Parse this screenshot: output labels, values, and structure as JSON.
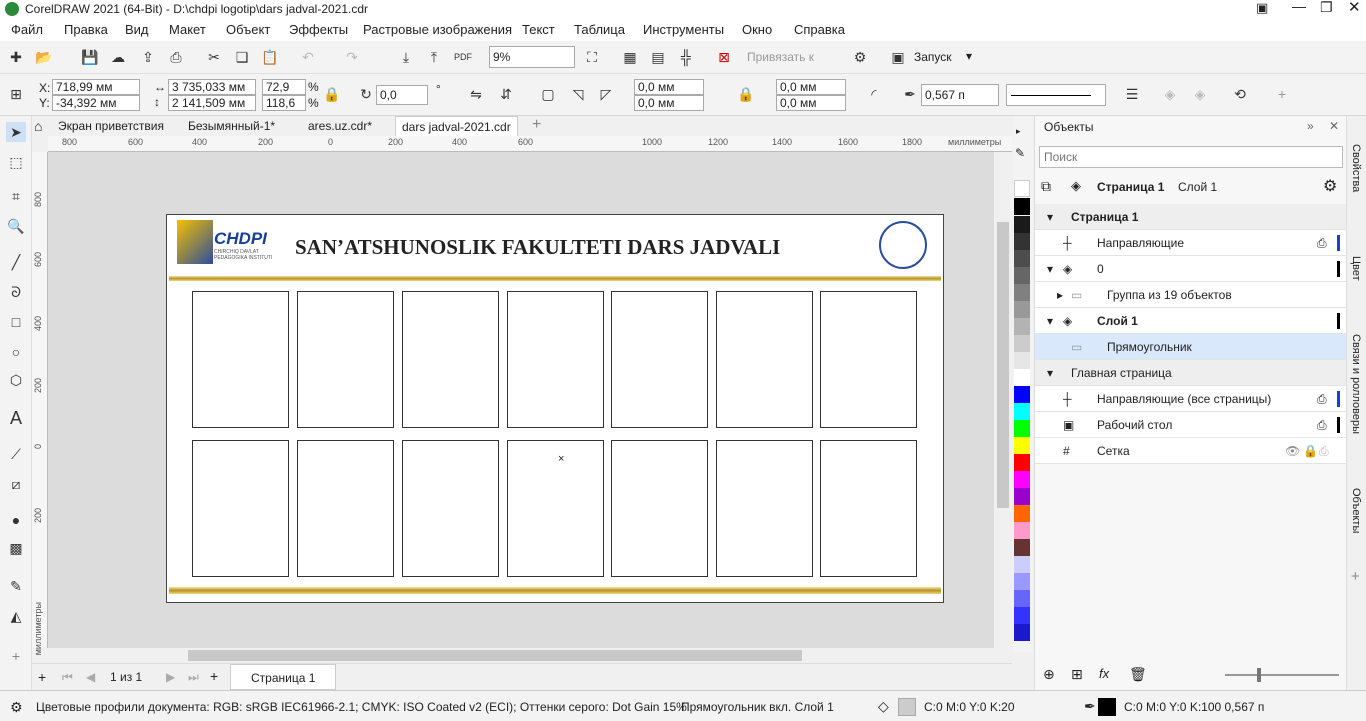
{
  "window": {
    "title": "CorelDRAW 2021 (64-Bit) - D:\\chdpi logotip\\dars jadval-2021.cdr"
  },
  "menu": [
    "Файл",
    "Правка",
    "Вид",
    "Макет",
    "Объект",
    "Эффекты",
    "Растровые изображения",
    "Текст",
    "Таблица",
    "Инструменты",
    "Окно",
    "Справка"
  ],
  "toolbar1": {
    "zoom": "9%",
    "snap_label": "Привязать к",
    "launch_label": "Запуск"
  },
  "toolbar2": {
    "x": "718,99 мм",
    "y": "-34,392 мм",
    "w": "3 735,033 мм",
    "h": "2 141,509 мм",
    "sx": "72,9",
    "sy": "118,6",
    "pct": "%",
    "rot": "0,0",
    "deg": "°",
    "c1": "0,0 мм",
    "c2": "0,0 мм",
    "c3": "0,0 мм",
    "c4": "0,0 мм",
    "outline": "0,567 п",
    "x_label": "X:",
    "y_label": "Y:"
  },
  "tabs": [
    "Экран приветствия",
    "Безымянный-1*",
    "ares.uz.cdr*",
    "dars jadval-2021.cdr"
  ],
  "ruler": {
    "h_ticks": [
      "800",
      "600",
      "400",
      "200",
      "0",
      "200",
      "400",
      "600",
      "1000",
      "1200",
      "1400",
      "1600",
      "1800"
    ],
    "unit": "миллиметры",
    "v_ticks": [
      "800",
      "600",
      "400",
      "200",
      "0",
      "200"
    ],
    "v_unit": "миллиметры"
  },
  "document": {
    "title": "SAN’ATSHUNOSLIK FAKULTETI DARS JADVALI",
    "logo_text": "CHDPI",
    "logo_sub": "CHIRCHIQ DAVLAT PEDAGOGIKA INSTITUTI"
  },
  "pager": {
    "counter": "1 из 1",
    "page_tab": "Страница 1"
  },
  "docker": {
    "title": "Объекты",
    "search_placeholder": "Поиск",
    "page_label": "Страница 1",
    "layer_label": "Слой 1",
    "rows": [
      "Страница 1",
      "Направляющие",
      "0",
      "Группа из 19 объектов",
      "Слой 1",
      "Прямоугольник",
      "Главная страница",
      "Направляющие (все страницы)",
      "Рабочий стол",
      "Сетка"
    ]
  },
  "side_tabs": [
    "Свойства",
    "Цвет",
    "Связи и ролловеры",
    "Объекты"
  ],
  "status": {
    "profiles": "Цветовые профили документа: RGB: sRGB IEC61966-2.1; CMYK: ISO Coated v2 (ECI); Оттенки серого: Dot Gain 15%",
    "selection": "Прямоугольник вкл. Слой 1",
    "fill": "C:0 M:0 Y:0 K:20",
    "outline": "C:0 M:0 Y:0 K:100  0,567 п"
  },
  "colors": {
    "accent": "#1a56c9",
    "gold": "#c9a22f"
  }
}
